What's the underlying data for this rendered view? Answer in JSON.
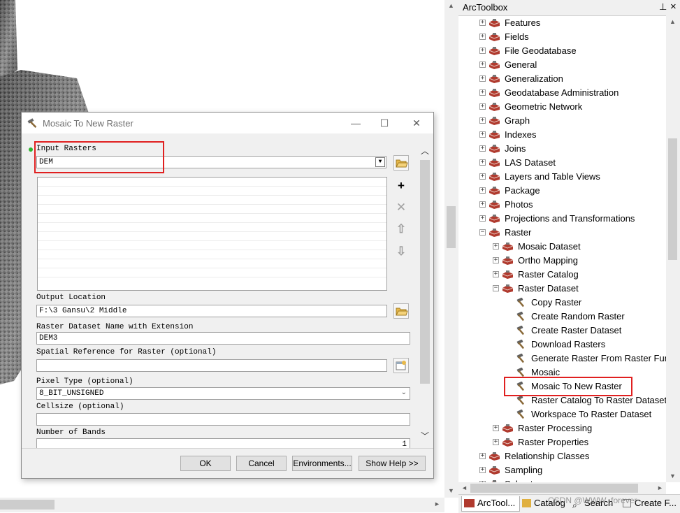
{
  "dialog": {
    "title": "Mosaic To New Raster",
    "input_rasters_label": "Input Rasters",
    "input_rasters_value": "DEM",
    "output_location_label": "Output Location",
    "output_location_value": "F:\\3 Gansu\\2 Middle",
    "dataset_name_label": "Raster Dataset Name with Extension",
    "dataset_name_value": "DEM3",
    "spatial_ref_label": "Spatial Reference for Raster (optional)",
    "spatial_ref_value": "",
    "pixel_type_label": "Pixel Type (optional)",
    "pixel_type_value": "8_BIT_UNSIGNED",
    "cellsize_label": "Cellsize (optional)",
    "cellsize_value": "",
    "bands_label": "Number of Bands",
    "bands_value": "1",
    "buttons": {
      "ok": "OK",
      "cancel": "Cancel",
      "environments": "Environments...",
      "show_help": "Show Help >>"
    }
  },
  "toolbox": {
    "title": "ArcToolbox",
    "pin": "⊥",
    "close": "×",
    "items": [
      {
        "label": "Features",
        "level": 0,
        "kind": "toolset",
        "expander": "+"
      },
      {
        "label": "Fields",
        "level": 0,
        "kind": "toolset",
        "expander": "+"
      },
      {
        "label": "File Geodatabase",
        "level": 0,
        "kind": "toolset",
        "expander": "+"
      },
      {
        "label": "General",
        "level": 0,
        "kind": "toolset",
        "expander": "+"
      },
      {
        "label": "Generalization",
        "level": 0,
        "kind": "toolset",
        "expander": "+"
      },
      {
        "label": "Geodatabase Administration",
        "level": 0,
        "kind": "toolset",
        "expander": "+"
      },
      {
        "label": "Geometric Network",
        "level": 0,
        "kind": "toolset",
        "expander": "+"
      },
      {
        "label": "Graph",
        "level": 0,
        "kind": "toolset",
        "expander": "+"
      },
      {
        "label": "Indexes",
        "level": 0,
        "kind": "toolset",
        "expander": "+"
      },
      {
        "label": "Joins",
        "level": 0,
        "kind": "toolset",
        "expander": "+"
      },
      {
        "label": "LAS Dataset",
        "level": 0,
        "kind": "toolset",
        "expander": "+"
      },
      {
        "label": "Layers and Table Views",
        "level": 0,
        "kind": "toolset",
        "expander": "+"
      },
      {
        "label": "Package",
        "level": 0,
        "kind": "toolset",
        "expander": "+"
      },
      {
        "label": "Photos",
        "level": 0,
        "kind": "toolset",
        "expander": "+"
      },
      {
        "label": "Projections and Transformations",
        "level": 0,
        "kind": "toolset",
        "expander": "+"
      },
      {
        "label": "Raster",
        "level": 0,
        "kind": "toolset",
        "expander": "−"
      },
      {
        "label": "Mosaic Dataset",
        "level": 1,
        "kind": "toolset",
        "expander": "+"
      },
      {
        "label": "Ortho Mapping",
        "level": 1,
        "kind": "toolset",
        "expander": "+"
      },
      {
        "label": "Raster Catalog",
        "level": 1,
        "kind": "toolset",
        "expander": "+"
      },
      {
        "label": "Raster Dataset",
        "level": 1,
        "kind": "toolset",
        "expander": "−"
      },
      {
        "label": "Copy Raster",
        "level": 2,
        "kind": "tool",
        "expander": ""
      },
      {
        "label": "Create Random Raster",
        "level": 2,
        "kind": "tool",
        "expander": ""
      },
      {
        "label": "Create Raster Dataset",
        "level": 2,
        "kind": "tool",
        "expander": ""
      },
      {
        "label": "Download Rasters",
        "level": 2,
        "kind": "tool",
        "expander": ""
      },
      {
        "label": "Generate Raster From Raster Function",
        "level": 2,
        "kind": "tool",
        "expander": ""
      },
      {
        "label": "Mosaic",
        "level": 2,
        "kind": "tool",
        "expander": ""
      },
      {
        "label": "Mosaic To New Raster",
        "level": 2,
        "kind": "tool",
        "expander": ""
      },
      {
        "label": "Raster Catalog To Raster Dataset",
        "level": 2,
        "kind": "tool",
        "expander": ""
      },
      {
        "label": "Workspace To Raster Dataset",
        "level": 2,
        "kind": "tool",
        "expander": ""
      },
      {
        "label": "Raster Processing",
        "level": 1,
        "kind": "toolset",
        "expander": "+"
      },
      {
        "label": "Raster Properties",
        "level": 1,
        "kind": "toolset",
        "expander": "+"
      },
      {
        "label": "Relationship Classes",
        "level": 0,
        "kind": "toolset",
        "expander": "+"
      },
      {
        "label": "Sampling",
        "level": 0,
        "kind": "toolset",
        "expander": "+"
      },
      {
        "label": "Subset",
        "level": 0,
        "kind": "toolset",
        "expander": "+"
      }
    ],
    "tabs": [
      {
        "label": "ArcTool..."
      },
      {
        "label": "Catalog"
      },
      {
        "label": "Search"
      },
      {
        "label": "Create F..."
      }
    ]
  },
  "watermark": "CSDN @WWW_forever",
  "colors": {
    "highlight_box": "#e02020",
    "toolset_icon": "#b03a2e",
    "tool_icon": "#606060",
    "status_dot": "#2fb52f"
  }
}
